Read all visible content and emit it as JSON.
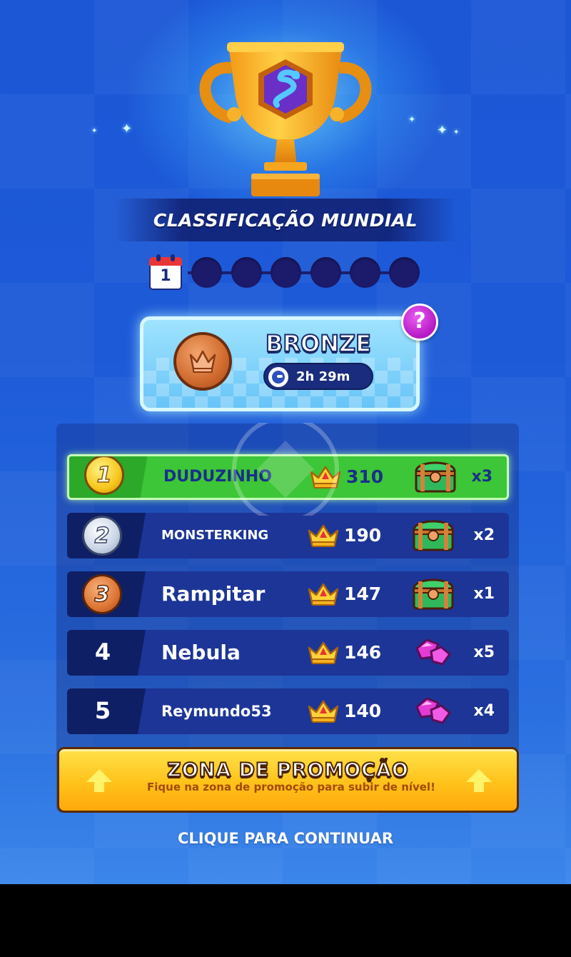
{
  "header": {
    "title": "CLASSIFICAÇÃO MUNDIAL",
    "trophy_icon": "snake-trophy-icon"
  },
  "progress": {
    "current_day": "1",
    "total_days": 7
  },
  "league": {
    "name": "BRONZE",
    "timer": "2h 29m",
    "help_label": "?"
  },
  "leaderboard": {
    "rows": [
      {
        "rank": "1",
        "name": "DUDUZINHO",
        "score": "310",
        "reward_icon": "chest-icon",
        "reward_qty": "x3",
        "highlighted": true
      },
      {
        "rank": "2",
        "name": "MONSTERKING",
        "score": "190",
        "reward_icon": "chest-icon",
        "reward_qty": "x2"
      },
      {
        "rank": "3",
        "name": "Rampitar",
        "score": "147",
        "reward_icon": "chest-icon",
        "reward_qty": "x1"
      },
      {
        "rank": "4",
        "name": "Nebula",
        "score": "146",
        "reward_icon": "gem-icon",
        "reward_qty": "x5"
      },
      {
        "rank": "5",
        "name": "Reymundo53",
        "score": "140",
        "reward_icon": "gem-icon",
        "reward_qty": "x4"
      }
    ]
  },
  "promotion": {
    "title": "ZONA DE PROMOÇÃO",
    "subtitle": "Fique na zona de promoção para subir de nível!"
  },
  "footer": {
    "continue_label": "CLIQUE PARA CONTINUAR"
  },
  "colors": {
    "background": "#1c57d6",
    "highlight_row": "#3dc637",
    "row": "#1c3597",
    "promo": "#ffc21a",
    "help": "#b418c4"
  }
}
